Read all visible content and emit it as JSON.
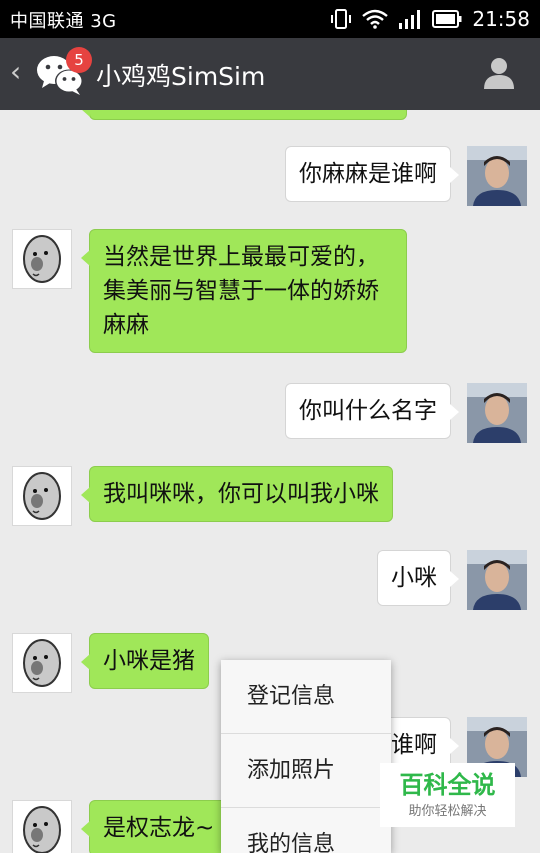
{
  "status_bar": {
    "carrier": "中国联通 3G",
    "time": "21:58",
    "icons": [
      "vibrate-icon",
      "wifi-icon",
      "signal-icon",
      "battery-icon"
    ]
  },
  "header": {
    "back_label": "‹",
    "app_icon": "wechat-icon",
    "unread_count": "5",
    "title": "小鸡鸡SimSim",
    "profile_icon": "person-icon"
  },
  "messages": [
    {
      "side": "right",
      "text": "你麻麻是谁啊"
    },
    {
      "side": "left",
      "text": "当然是世界上最最可爱的，集美丽与智慧于一体的娇娇麻麻"
    },
    {
      "side": "right",
      "text": "你叫什么名字"
    },
    {
      "side": "left",
      "text": "我叫咪咪，你可以叫我小咪"
    },
    {
      "side": "right",
      "text": "小咪"
    },
    {
      "side": "left",
      "text": "小咪是猪"
    },
    {
      "side": "right",
      "text": "谁啊"
    },
    {
      "side": "left",
      "text": "是权志龙~"
    }
  ],
  "context_menu": {
    "items": [
      "登记信息",
      "添加照片",
      "我的信息"
    ]
  },
  "watermark": {
    "main": "百科全说",
    "sub": "助你轻松解决"
  },
  "colors": {
    "header_bg": "#393a3f",
    "received_bubble": "#a0e759",
    "sent_bubble": "#ffffff",
    "badge": "#e64340",
    "watermark_text": "#2fb84a"
  }
}
